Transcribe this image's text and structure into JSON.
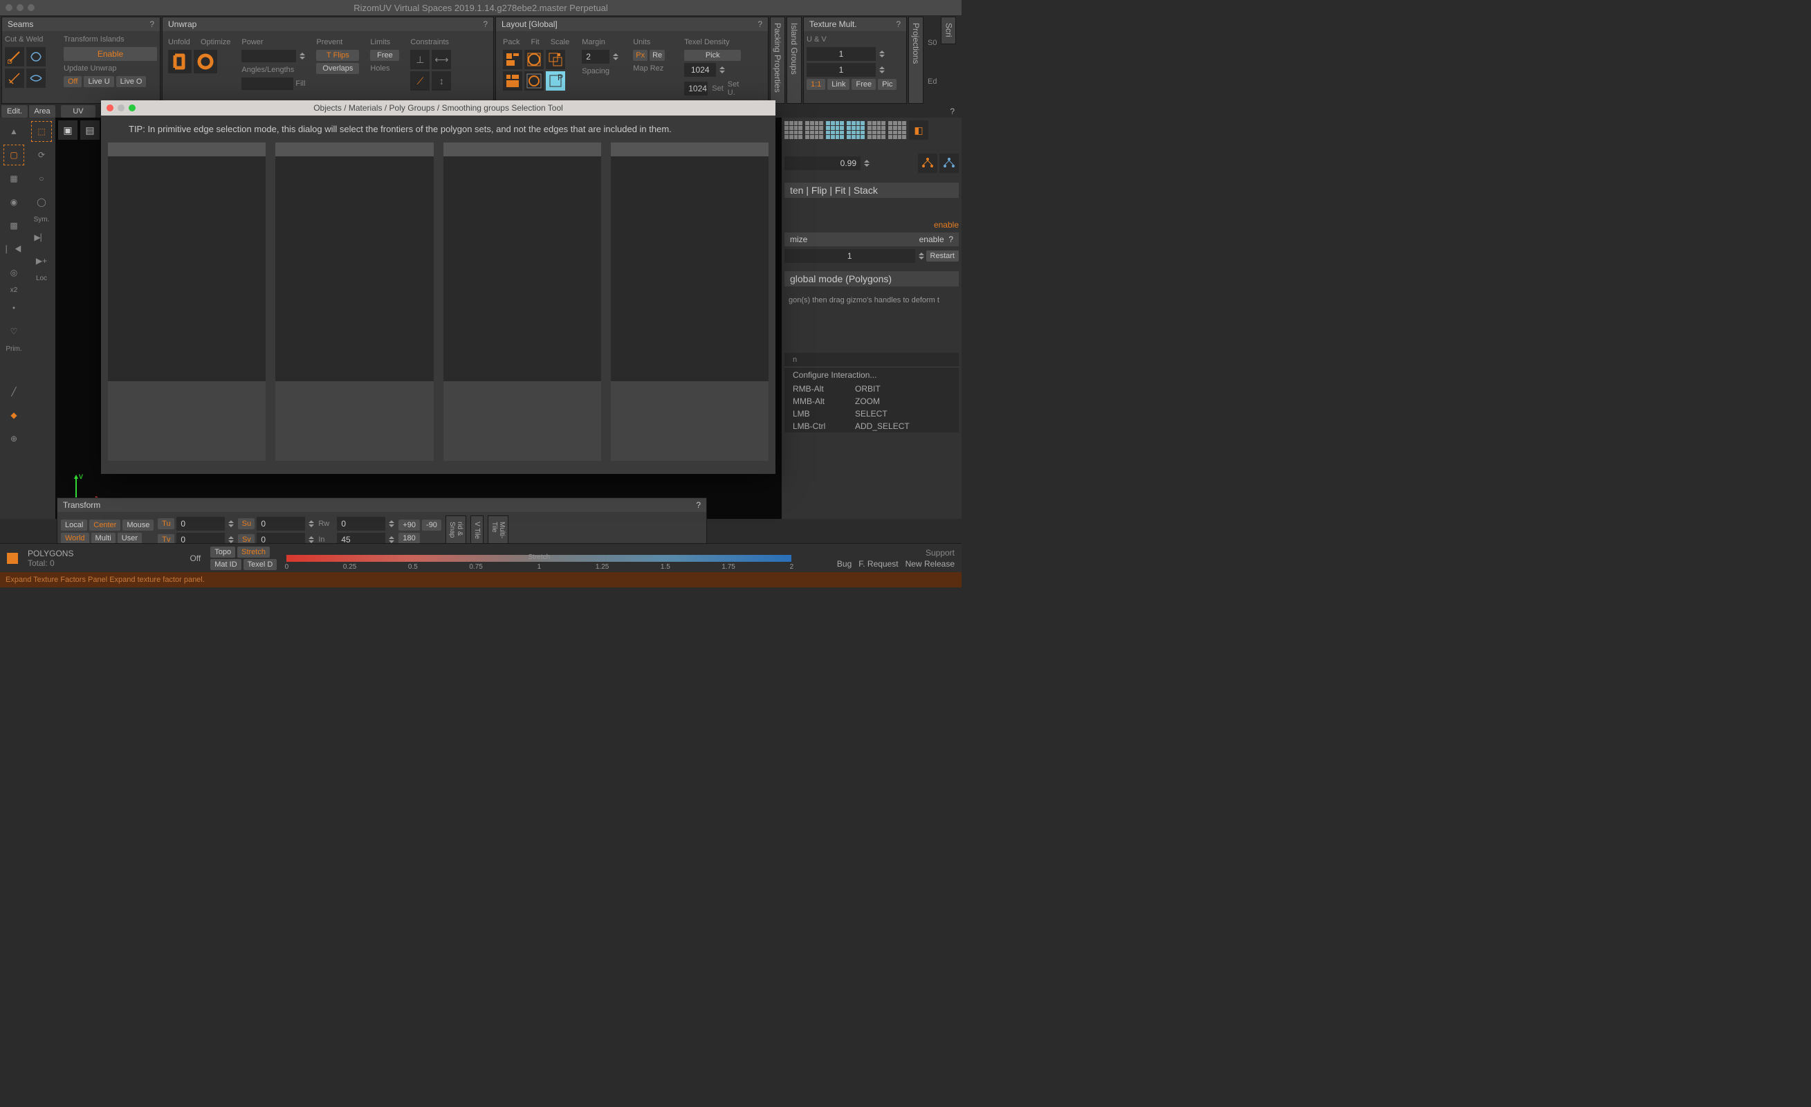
{
  "app_title": "RizomUV  Virtual Spaces 2019.1.14.g278ebe2.master Perpetual",
  "panels": {
    "seams": {
      "title": "Seams",
      "cut_weld": "Cut & Weld",
      "transform_islands": "Transform Islands",
      "enable": "Enable",
      "update_unwrap": "Update Unwrap",
      "off": "Off",
      "live_u": "Live U",
      "live_o": "Live O"
    },
    "unwrap": {
      "title": "Unwrap",
      "unfold": "Unfold",
      "optimize": "Optimize",
      "power": "Power",
      "angles_lengths": "Angles/Lengths",
      "fill": "Fill",
      "prevent": "Prevent",
      "t_flips": "T Flips",
      "overlaps": "Overlaps",
      "limits": "Limits",
      "free": "Free",
      "holes": "Holes",
      "constraints": "Constraints"
    },
    "layout": {
      "title": "Layout [Global]",
      "pack": "Pack",
      "fit": "Fit",
      "scale": "Scale",
      "margin": "Margin",
      "margin_val": "2",
      "spacing": "Spacing",
      "units": "Units",
      "px": "Px",
      "re": "Re",
      "map_rez": "Map Rez",
      "map_rez_val": "1024",
      "set_val": "1024",
      "set": "Set",
      "set_u": "Set U.",
      "texel_density": "Texel Density",
      "pick": "Pick"
    },
    "texmult": {
      "title": "Texture Mult.",
      "uv": "U & V",
      "val": "1",
      "one_one": "1:1",
      "link": "Link",
      "free": "Free",
      "pic": "Pic"
    },
    "vert_tabs": {
      "packing": "Packing Properties",
      "island": "Island Groups",
      "projections": "Projections",
      "scripts": "Scri"
    },
    "side_labels": {
      "s0": "S0",
      "ed": "Ed"
    }
  },
  "left": {
    "edit": "Edit.",
    "area": "Area",
    "uv": "UV",
    "sym": "Sym.",
    "loc": "Loc",
    "x2": "x2",
    "prim": "Prim."
  },
  "right": {
    "val099": "0.99",
    "flatten": "ten | Flip | Fit | Stack",
    "enable": "enable",
    "optimize": "mize",
    "opt_enable": "enable",
    "opt_q": "?",
    "opt_val": "1",
    "restart": "Restart",
    "globalmode": "global mode (Polygons)",
    "globalhint": "gon(s) then drag gizmo's handles to deform t",
    "configure": "Configure Interaction...",
    "shortcuts": [
      [
        "RMB-Alt",
        "ORBIT"
      ],
      [
        "MMB-Alt",
        "ZOOM"
      ],
      [
        "LMB",
        "SELECT"
      ],
      [
        "LMB-Ctrl",
        "ADD_SELECT"
      ]
    ]
  },
  "modal": {
    "title": "Objects / Materials / Poly Groups / Smoothing groups Selection Tool",
    "tip": "TIP: In primitive edge selection mode, this dialog will select the frontiers of the polygon sets, and not the edges that are included in them."
  },
  "transform": {
    "title": "Transform",
    "local": "Local",
    "center": "Center",
    "mouse": "Mouse",
    "world": "World",
    "multi": "Multi",
    "user": "User",
    "tu": "Tu",
    "tv": "Tv",
    "su": "Su",
    "sv": "Sv",
    "rw": "Rw",
    "in": "In",
    "tu_v": "0",
    "tv_v": "0",
    "su_v": "0",
    "sv_v": "0",
    "rw_v": "0",
    "in_v": "45",
    "p90": "+90",
    "m90": "-90",
    "r180": "180",
    "grid_snap": "rid & Snap",
    "uv_tile": "V Tile",
    "multi_tile": "Multi-Tile"
  },
  "status": {
    "polygons": "POLYGONS",
    "total": "Total: 0",
    "off": "Off",
    "topo": "Topo",
    "stretch_btn": "Stretch",
    "matid": "Mat ID",
    "texeld": "Texel D",
    "stretch_lbl": "Stretch",
    "ticks": [
      "0",
      "0.25",
      "0.5",
      "0.75",
      "1",
      "1.25",
      "1.5",
      "1.75",
      "2"
    ],
    "support": "Support",
    "bug": "Bug",
    "frequest": "F. Request",
    "newrelease": "New Release"
  },
  "hint": "Expand Texture Factors Panel  Expand texture factor panel."
}
